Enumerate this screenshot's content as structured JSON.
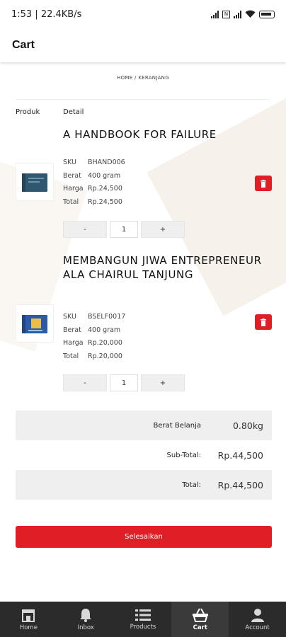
{
  "status_bar": {
    "time": "1:53 | 22.4KB/s",
    "battery": "100"
  },
  "app_bar": {
    "title": "Cart"
  },
  "breadcrumb": "HOME / KERANJANG",
  "table_headers": {
    "product": "Produk",
    "detail": "Detail"
  },
  "spec_labels": {
    "sku": "SKU",
    "weight": "Berat",
    "price": "Harga",
    "total": "Total"
  },
  "items": [
    {
      "title": "A HANDBOOK FOR FAILURE",
      "sku": "BHAND006",
      "weight": "400 gram",
      "price": "Rp.24,500",
      "total": "Rp.24,500",
      "qty": "1",
      "minus": "-",
      "plus": "+",
      "book_color": "#2f5870"
    },
    {
      "title": "MEMBANGUN JIWA ENTREPRENEUR ALA CHAIRUL TANJUNG",
      "sku": "BSELF0017",
      "weight": "400 gram",
      "price": "Rp.20,000",
      "total": "Rp.20,000",
      "qty": "1",
      "minus": "-",
      "plus": "+",
      "book_color": "#2a5aa8"
    }
  ],
  "summary": {
    "weight_label": "Berat Belanja",
    "weight_value": "0.80kg",
    "subtotal_label": "Sub-Total:",
    "subtotal_value": "Rp.44,500",
    "total_label": "Total:",
    "total_value": "Rp.44,500"
  },
  "checkout_label": "Selesaikan",
  "nav": [
    {
      "label": "Home",
      "icon": "store-icon"
    },
    {
      "label": "Inbox",
      "icon": "bell-icon"
    },
    {
      "label": "Products",
      "icon": "list-icon"
    },
    {
      "label": "Cart",
      "icon": "basket-icon",
      "active": true
    },
    {
      "label": "Account",
      "icon": "person-icon"
    }
  ],
  "colors": {
    "accent": "#e01e26",
    "nav_bg": "#2b2b2b",
    "shade": "#efefef"
  }
}
